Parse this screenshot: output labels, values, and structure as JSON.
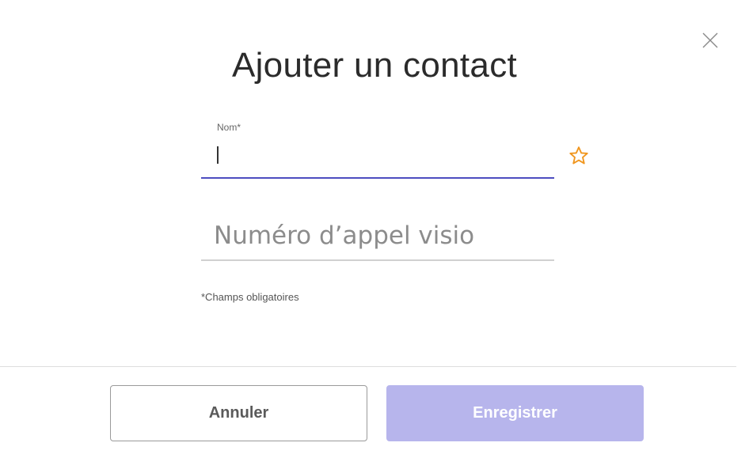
{
  "dialog": {
    "title": "Ajouter un contact",
    "close_icon": "close-icon"
  },
  "form": {
    "nom": {
      "label": "Nom*",
      "value": ""
    },
    "favorite_icon": "star-outline-icon",
    "visio": {
      "placeholder": "Numéro d’appel visio",
      "value": ""
    },
    "required_note": "*Champs obligatoires"
  },
  "actions": {
    "cancel_label": "Annuler",
    "save_label": "Enregistrer"
  },
  "colors": {
    "accent": "#4d4dc0",
    "star": "#f0961e",
    "save_disabled_bg": "#b7b5ec"
  }
}
